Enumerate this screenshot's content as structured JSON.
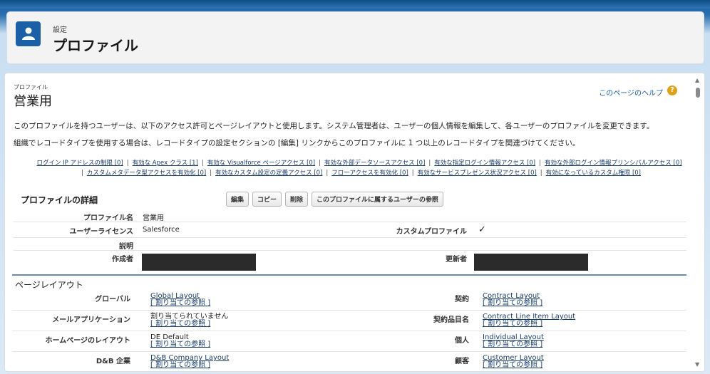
{
  "header": {
    "eyebrow": "設定",
    "title": "プロファイル"
  },
  "page": {
    "eyebrow": "プロファイル",
    "title": "営業用",
    "help_link": "このページのヘルプ",
    "description_1": "このプロファイルを持つユーザーは、以下のアクセス許可とページレイアウトと使用します。システム管理者は、ユーザーの個人情報を編集して、各ユーザーのプロファイルを変更できます。",
    "description_2": "組織でレコードタイプを使用する場合は、レコードタイプの設定セクションの [編集] リンクからこのプロファイルに 1 つ以上のレコードタイプを関連づけてください。"
  },
  "related_links": {
    "line1": [
      "ログイン IP アドレスの制限 [0]",
      "有効な Apex クラス [1]",
      "有効な Visualforce ページアクセス [0]",
      "有効な外部データソースアクセス [0]",
      "有効な指定ログイン情報アクセス [0]",
      "有効な外部ログイン情報プリンシパルアクセス [0]"
    ],
    "line2": [
      "カスタムメタデータ型アクセスを有効化 [0]",
      "有効なカスタム設定の定義アクセス [0]",
      "フローアクセスを有効化 [0]",
      "有効なサービスプレゼンス状況アクセス [0]",
      "有効になっているカスタム権限 [0]"
    ]
  },
  "detail": {
    "section_title": "プロファイルの詳細",
    "buttons": {
      "edit": "編集",
      "copy": "コピー",
      "delete": "削除",
      "view_users": "このプロファイルに属するユーザーの参照"
    },
    "profile_name_label": "プロファイル名",
    "profile_name": "営業用",
    "user_license_label": "ユーザーライセンス",
    "user_license": "Salesforce",
    "custom_profile_label": "カスタムプロファイル",
    "custom_profile_check": "✓",
    "description_label": "説明",
    "created_by_label": "作成者",
    "modified_by_label": "更新者"
  },
  "page_layouts": {
    "section_title": "ページレイアウト",
    "assign_label": "[ 割り当ての参照 ]",
    "rows": [
      {
        "left_label": "グローバル",
        "left_value": "Global Layout",
        "right_label": "契約",
        "right_value": "Contract Layout"
      },
      {
        "left_label": "メールアプリケーション",
        "left_value": "割り当てられていません",
        "right_label": "契約品目名",
        "right_value": "Contract Line Item Layout"
      },
      {
        "left_label": "ホームページのレイアウト",
        "left_value": "DE Default",
        "right_label": "個人",
        "right_value": "Individual Layout"
      },
      {
        "left_label": "D&B 企業",
        "left_value": "D&B Company Layout",
        "right_label": "顧客",
        "right_value": "Customer Layout"
      }
    ]
  },
  "colors": {
    "brand_blue": "#1b5fa6",
    "link": "#1a5da8",
    "help_icon": "#e0a21b",
    "redaction": "#2b2b2b"
  }
}
